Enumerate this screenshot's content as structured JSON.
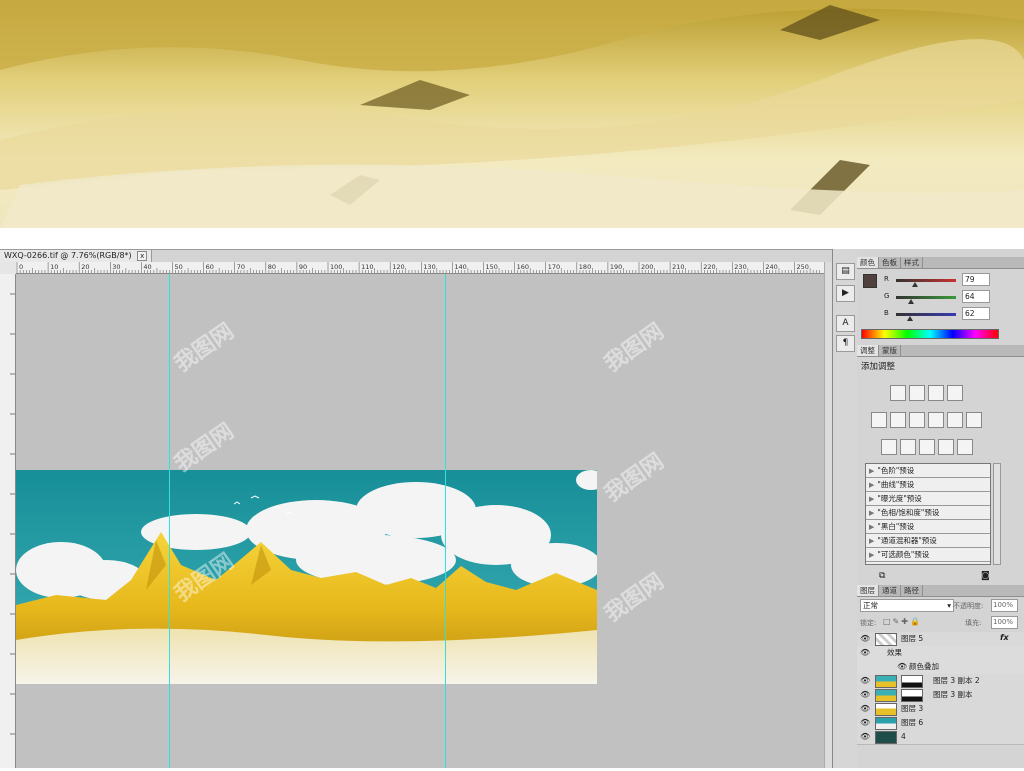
{
  "document": {
    "tab_title": "WXQ-0266.tif @ 7.76%(RGB/8*)",
    "close_label": "x"
  },
  "ruler": {
    "ticks": [
      "0",
      "10",
      "20",
      "30",
      "40",
      "50",
      "60",
      "70",
      "80",
      "90",
      "100",
      "110",
      "120",
      "130",
      "140",
      "150",
      "160",
      "170",
      "180",
      "190",
      "200",
      "210",
      "220",
      "230",
      "240",
      "250",
      "260"
    ]
  },
  "color_panel": {
    "tabs": [
      "颜色",
      "色板",
      "样式"
    ],
    "channels": [
      {
        "label": "R",
        "value": "79",
        "level": 0.31,
        "color": "#c83232"
      },
      {
        "label": "G",
        "value": "64",
        "level": 0.25,
        "color": "#3a9a3a"
      },
      {
        "label": "B",
        "value": "62",
        "level": 0.24,
        "color": "#3a3ab0"
      }
    ],
    "foreground_color": "#4f403e",
    "background_color": "#ffffff"
  },
  "adjustments_panel": {
    "tabs": [
      "调整",
      "蒙版"
    ],
    "heading": "添加调整",
    "presets": [
      "\"色阶\"预设",
      "\"曲线\"预设",
      "\"曝光度\"预设",
      "\"色相/饱和度\"预设",
      "\"黑白\"预设",
      "\"通道混和器\"预设",
      "\"可选颜色\"预设"
    ]
  },
  "layers_panel": {
    "tabs": [
      "图层",
      "通道",
      "路径"
    ],
    "blend_mode": "正常",
    "opacity_label": "不透明度:",
    "opacity_value": "100%",
    "lock_label": "锁定:",
    "fill_label": "填充:",
    "fill_value": "100%",
    "fx_label": "fx",
    "layers": [
      {
        "name": "图层 5",
        "kind": "layer",
        "fx": true
      },
      {
        "name": "效果",
        "kind": "effects"
      },
      {
        "name": "颜色叠加",
        "kind": "effect"
      },
      {
        "name": "图层 3 副本 2",
        "kind": "masked"
      },
      {
        "name": "图层 3 副本",
        "kind": "masked"
      },
      {
        "name": "图层 3",
        "kind": "layer"
      },
      {
        "name": "图层 6",
        "kind": "layer"
      },
      {
        "name": "4",
        "kind": "layer"
      }
    ]
  },
  "watermark_text": "我图网"
}
